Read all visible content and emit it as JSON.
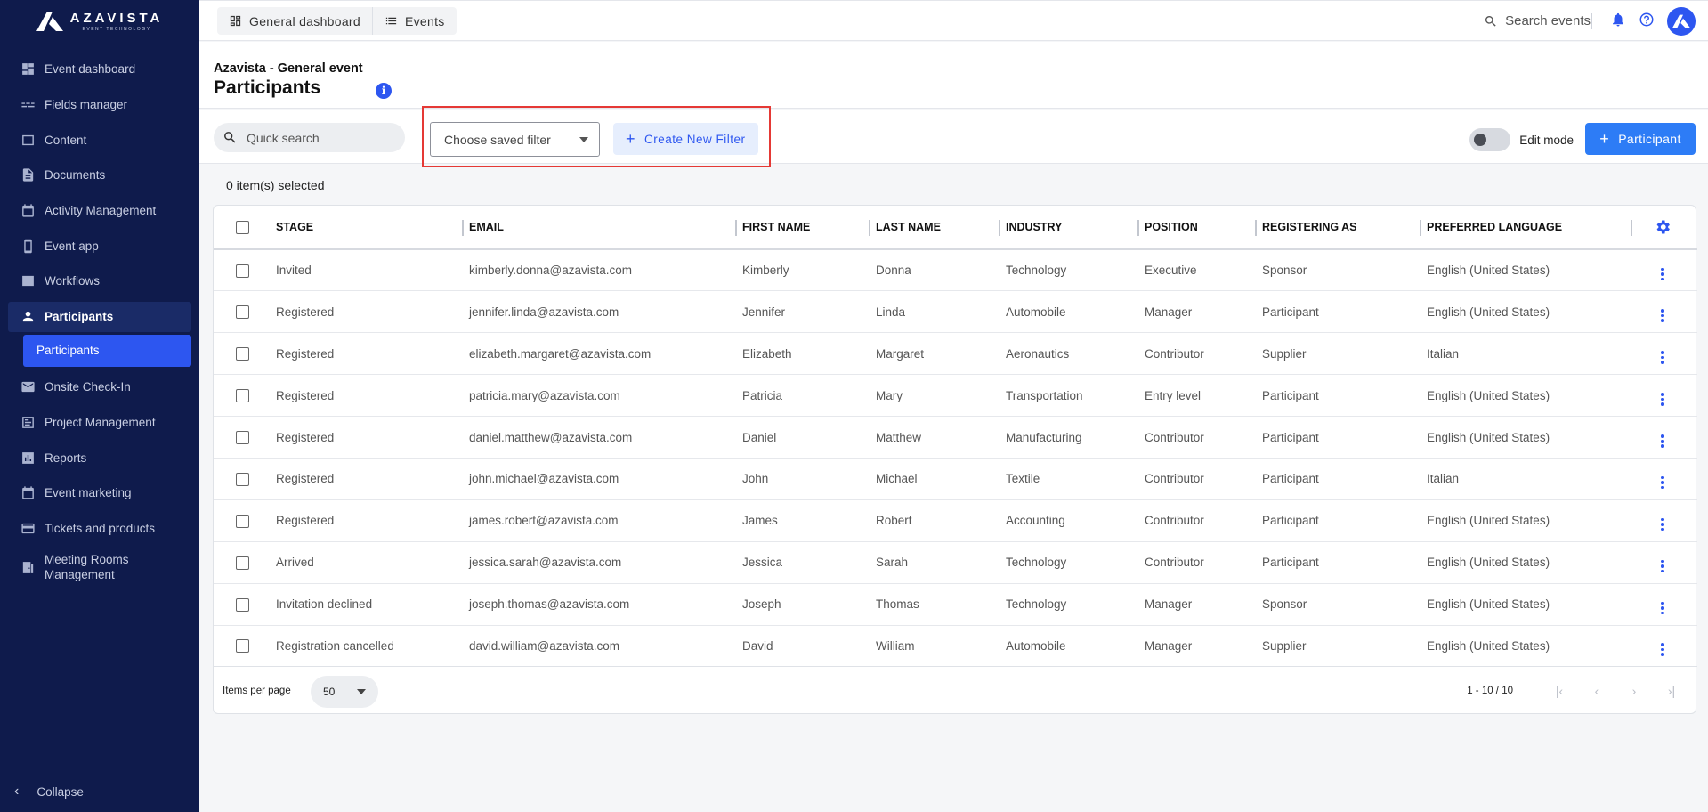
{
  "brand": {
    "name": "AZAVISTA",
    "tagline": "EVENT TECHNOLOGY",
    "accent": "#2d56f0",
    "sidebar_bg": "#0f1b4c"
  },
  "sidebar": {
    "items": [
      {
        "label": "Event dashboard",
        "icon": "dashboard-icon"
      },
      {
        "label": "Fields manager",
        "icon": "fields-icon"
      },
      {
        "label": "Content",
        "icon": "content-icon"
      },
      {
        "label": "Documents",
        "icon": "document-icon"
      },
      {
        "label": "Activity Management",
        "icon": "calendar-icon"
      },
      {
        "label": "Event app",
        "icon": "phone-icon"
      },
      {
        "label": "Workflows",
        "icon": "workflow-icon"
      },
      {
        "label": "Participants",
        "icon": "person-icon",
        "active": true
      },
      {
        "label": "Onsite Check-In",
        "icon": "mail-icon"
      },
      {
        "label": "Project Management",
        "icon": "project-icon"
      },
      {
        "label": "Reports",
        "icon": "chart-icon"
      },
      {
        "label": "Event marketing",
        "icon": "calendar-icon"
      },
      {
        "label": "Tickets and products",
        "icon": "card-icon"
      },
      {
        "label": "Meeting Rooms Management",
        "icon": "room-icon"
      }
    ],
    "sub_item": "Participants",
    "collapse_label": "Collapse"
  },
  "topbar": {
    "tab_dashboard": "General dashboard",
    "tab_events": "Events",
    "search_placeholder": "Search events"
  },
  "header": {
    "event_name": "Azavista - General event",
    "title": "Participants"
  },
  "filters": {
    "quick_search_placeholder": "Quick search",
    "saved_filter_placeholder": "Choose saved filter",
    "create_filter_label": "Create New Filter",
    "edit_mode_label": "Edit mode",
    "add_participant_label": "Participant"
  },
  "selected_count": "0 item(s) selected",
  "table": {
    "columns": [
      "STAGE",
      "EMAIL",
      "FIRST NAME",
      "LAST NAME",
      "INDUSTRY",
      "POSITION",
      "REGISTERING AS",
      "PREFERRED LANGUAGE"
    ],
    "rows": [
      [
        "Invited",
        "kimberly.donna@azavista.com",
        "Kimberly",
        "Donna",
        "Technology",
        "Executive",
        "Sponsor",
        "English (United States)"
      ],
      [
        "Registered",
        "jennifer.linda@azavista.com",
        "Jennifer",
        "Linda",
        "Automobile",
        "Manager",
        "Participant",
        "English (United States)"
      ],
      [
        "Registered",
        "elizabeth.margaret@azavista.com",
        "Elizabeth",
        "Margaret",
        "Aeronautics",
        "Contributor",
        "Supplier",
        "Italian"
      ],
      [
        "Registered",
        "patricia.mary@azavista.com",
        "Patricia",
        "Mary",
        "Transportation",
        "Entry level",
        "Participant",
        "English (United States)"
      ],
      [
        "Registered",
        "daniel.matthew@azavista.com",
        "Daniel",
        "Matthew",
        "Manufacturing",
        "Contributor",
        "Participant",
        "English (United States)"
      ],
      [
        "Registered",
        "john.michael@azavista.com",
        "John",
        "Michael",
        "Textile",
        "Contributor",
        "Participant",
        "Italian"
      ],
      [
        "Registered",
        "james.robert@azavista.com",
        "James",
        "Robert",
        "Accounting",
        "Contributor",
        "Participant",
        "English (United States)"
      ],
      [
        "Arrived",
        "jessica.sarah@azavista.com",
        "Jessica",
        "Sarah",
        "Technology",
        "Contributor",
        "Participant",
        "English (United States)"
      ],
      [
        "Invitation declined",
        "joseph.thomas@azavista.com",
        "Joseph",
        "Thomas",
        "Technology",
        "Manager",
        "Sponsor",
        "English (United States)"
      ],
      [
        "Registration cancelled",
        "david.william@azavista.com",
        "David",
        "William",
        "Automobile",
        "Manager",
        "Supplier",
        "English (United States)"
      ]
    ]
  },
  "pagination": {
    "items_per_page_label": "Items per page",
    "items_per_page": "50",
    "range": "1 - 10 / 10"
  }
}
